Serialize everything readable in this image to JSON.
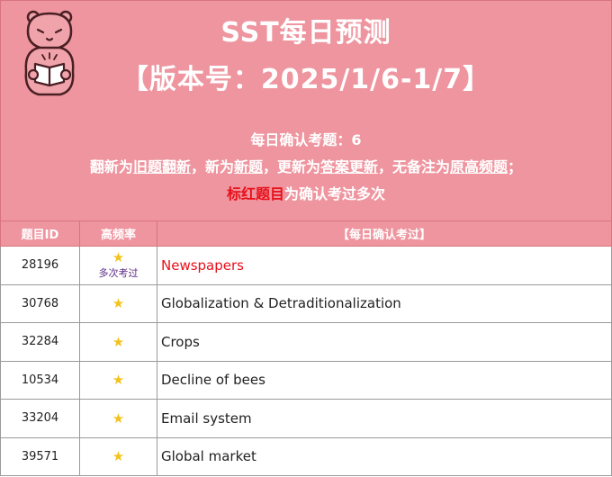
{
  "header": {
    "title": "SST每日预测",
    "version": "【版本号：2025/1/6-1/7】",
    "confirm_count_label": "每日确认考题：6",
    "legend_line": {
      "p1": "翻新为",
      "u1": "旧题翻新",
      "p2": "，新为",
      "u2": "新题",
      "p3": "，更新为",
      "u3": "答案更新",
      "p4": "，无备注为",
      "u4": "原高频题",
      "p5": "；"
    },
    "red_line": {
      "red": "标红题目",
      "rest": "为确认考过多次"
    }
  },
  "table": {
    "columns": [
      "题目ID",
      "高频率",
      "【每日确认考过】"
    ],
    "rows": [
      {
        "id": "28196",
        "star": "★",
        "note": "多次考过",
        "topic": "Newspapers",
        "red": true
      },
      {
        "id": "30768",
        "star": "★",
        "note": "",
        "topic": "Globalization & Detraditionalization",
        "red": false
      },
      {
        "id": "32284",
        "star": "★",
        "note": "",
        "topic": "Crops",
        "red": false
      },
      {
        "id": "10534",
        "star": "★",
        "note": "",
        "topic": "Decline of bees",
        "red": false
      },
      {
        "id": "33204",
        "star": "★",
        "note": "",
        "topic": "Email system",
        "red": false
      },
      {
        "id": "39571",
        "star": "★",
        "note": "",
        "topic": "Global market",
        "red": false
      }
    ]
  },
  "colors": {
    "banner": "#ee959f",
    "highlight_red": "#e8101a",
    "star": "#f3c21b",
    "note_purple": "#5d2b86"
  },
  "icons": {
    "mascot": "bear-reading-book-icon"
  }
}
